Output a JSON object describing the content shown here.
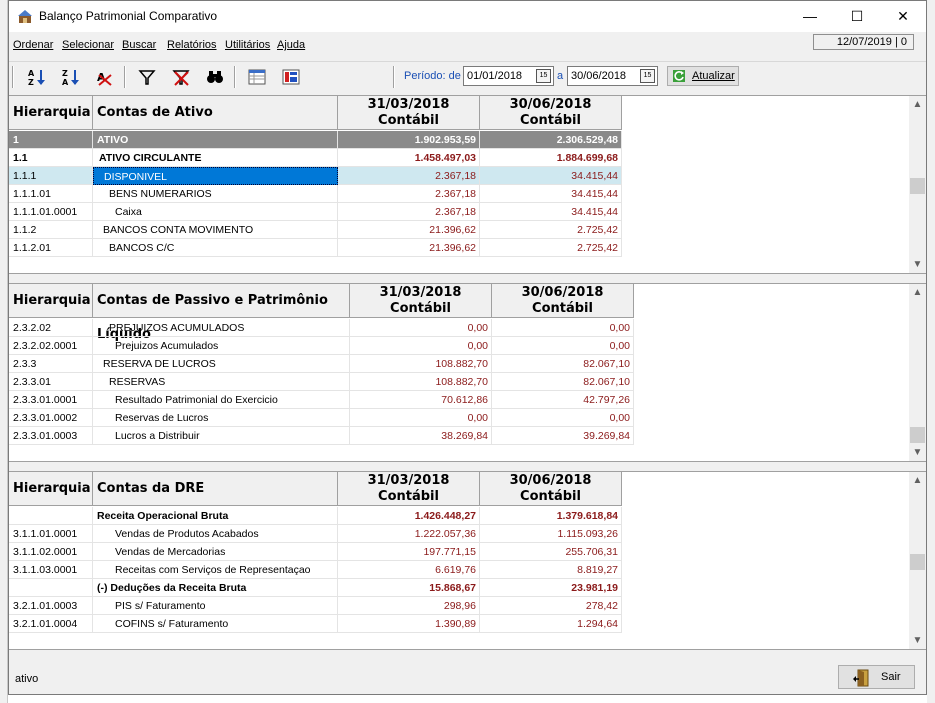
{
  "window": {
    "title": "Balanço Patrimonial Comparativo",
    "minimize": "—",
    "maximize": "☐",
    "close": "✕"
  },
  "menu": [
    "Ordenar",
    "Selecionar",
    "Buscar",
    "Relatórios",
    "Utilitários",
    "Ajuda"
  ],
  "date_display": "12/07/2019 | 0",
  "toolbar": {
    "periodo_label": "Período: de",
    "date_from": "01/01/2018",
    "a_label": "a",
    "date_to": "30/06/2018",
    "cal_label": "15",
    "refresh_label": "Atualizar",
    "icons": [
      "sort-az-icon",
      "sort-za-icon",
      "clear-sort-icon",
      "filter-icon",
      "clear-filter-icon",
      "binoculars-icon",
      "layout-icon",
      "report-icon"
    ]
  },
  "ativo": {
    "headers": {
      "hier": "Hierarquia",
      "contas": "Contas de Ativo",
      "d1": "31/03/2018",
      "d2": "30/06/2018",
      "sub": "Contábil"
    },
    "rows": [
      {
        "h": "1",
        "c": "ATIVO",
        "v1": "1.902.953,59",
        "v2": "2.306.529,48",
        "style": "gray"
      },
      {
        "h": "1.1",
        "c": "ATIVO CIRCULANTE",
        "v1": "1.458.497,03",
        "v2": "1.884.699,68",
        "style": "bold"
      },
      {
        "h": "1.1.1",
        "c": "DISPONIVEL",
        "v1": "2.367,18",
        "v2": "34.415,44",
        "style": "selected"
      },
      {
        "h": "1.1.1.01",
        "c": "BENS NUMERARIOS",
        "v1": "2.367,18",
        "v2": "34.415,44",
        "style": ""
      },
      {
        "h": "1.1.1.01.0001",
        "c": "Caixa",
        "v1": "2.367,18",
        "v2": "34.415,44",
        "style": ""
      },
      {
        "h": "1.1.2",
        "c": "BANCOS CONTA MOVIMENTO",
        "v1": "21.396,62",
        "v2": "2.725,42",
        "style": ""
      },
      {
        "h": "1.1.2.01",
        "c": "BANCOS C/C",
        "v1": "21.396,62",
        "v2": "2.725,42",
        "style": ""
      }
    ]
  },
  "passivo": {
    "headers": {
      "hier": "Hierarquia",
      "contas": "Contas de Passivo e Patrimônio Líquido",
      "d1": "31/03/2018",
      "d2": "30/06/2018",
      "sub": "Contábil"
    },
    "rows": [
      {
        "h": "2.3.2.02",
        "c": "PREJUIZOS ACUMULADOS",
        "v1": "0,00",
        "v2": "0,00",
        "style": ""
      },
      {
        "h": "2.3.2.02.0001",
        "c": "Prejuizos Acumulados",
        "v1": "0,00",
        "v2": "0,00",
        "style": ""
      },
      {
        "h": "2.3.3",
        "c": "RESERVA DE LUCROS",
        "v1": "108.882,70",
        "v2": "82.067,10",
        "style": ""
      },
      {
        "h": "2.3.3.01",
        "c": "RESERVAS",
        "v1": "108.882,70",
        "v2": "82.067,10",
        "style": ""
      },
      {
        "h": "2.3.3.01.0001",
        "c": "Resultado Patrimonial do Exercicio",
        "v1": "70.612,86",
        "v2": "42.797,26",
        "style": ""
      },
      {
        "h": "2.3.3.01.0002",
        "c": "Reservas de Lucros",
        "v1": "0,00",
        "v2": "0,00",
        "style": ""
      },
      {
        "h": "2.3.3.01.0003",
        "c": "Lucros a Distribuir",
        "v1": "38.269,84",
        "v2": "39.269,84",
        "style": ""
      }
    ]
  },
  "dre": {
    "headers": {
      "hier": "Hierarquia",
      "contas": "Contas da DRE",
      "d1": "31/03/2018",
      "d2": "30/06/2018",
      "sub": "Contábil"
    },
    "rows": [
      {
        "h": "",
        "c": "Receita Operacional Bruta",
        "v1": "1.426.448,27",
        "v2": "1.379.618,84",
        "style": "bold"
      },
      {
        "h": "3.1.1.01.0001",
        "c": "Vendas de Produtos Acabados",
        "v1": "1.222.057,36",
        "v2": "1.115.093,26",
        "style": ""
      },
      {
        "h": "3.1.1.02.0001",
        "c": "Vendas de Mercadorias",
        "v1": "197.771,15",
        "v2": "255.706,31",
        "style": ""
      },
      {
        "h": "3.1.1.03.0001",
        "c": "Receitas com Serviços de Representaçao",
        "v1": "6.619,76",
        "v2": "8.819,27",
        "style": ""
      },
      {
        "h": "",
        "c": "(-) Deduções da Receita Bruta",
        "v1": "15.868,67",
        "v2": "23.981,19",
        "style": "bold"
      },
      {
        "h": "3.2.1.01.0003",
        "c": "PIS s/ Faturamento",
        "v1": "298,96",
        "v2": "278,42",
        "style": ""
      },
      {
        "h": "3.2.1.01.0004",
        "c": "COFINS s/ Faturamento",
        "v1": "1.390,89",
        "v2": "1.294,64",
        "style": ""
      }
    ]
  },
  "status": {
    "text": "ativo",
    "sair_label": "Sair"
  }
}
